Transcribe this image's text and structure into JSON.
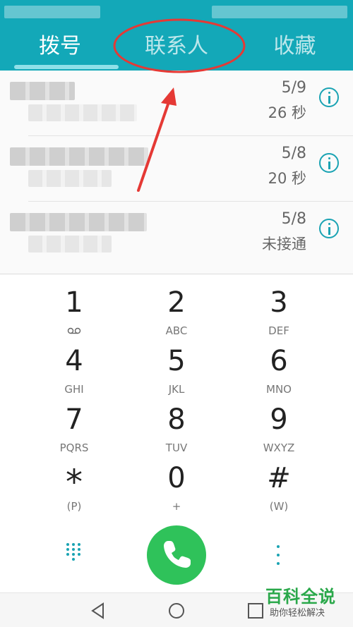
{
  "tabs": [
    {
      "label": "拨号",
      "active": true
    },
    {
      "label": "联系人",
      "active": false
    },
    {
      "label": "收藏",
      "active": false
    }
  ],
  "call_log": [
    {
      "date": "5/9",
      "meta": "26 秒"
    },
    {
      "date": "5/8",
      "meta": "20 秒"
    },
    {
      "date": "5/8",
      "meta": "未接通"
    }
  ],
  "keypad": [
    {
      "digit": "1",
      "letters": ""
    },
    {
      "digit": "2",
      "letters": "ABC"
    },
    {
      "digit": "3",
      "letters": "DEF"
    },
    {
      "digit": "4",
      "letters": "GHI"
    },
    {
      "digit": "5",
      "letters": "JKL"
    },
    {
      "digit": "6",
      "letters": "MNO"
    },
    {
      "digit": "7",
      "letters": "PQRS"
    },
    {
      "digit": "8",
      "letters": "TUV"
    },
    {
      "digit": "9",
      "letters": "WXYZ"
    },
    {
      "digit": "*",
      "letters": "(P)"
    },
    {
      "digit": "0",
      "letters": "+"
    },
    {
      "digit": "#",
      "letters": "(W)"
    }
  ],
  "icons": {
    "info": "info-icon",
    "call": "phone-icon",
    "dialpad": "dialpad-icon",
    "more": "more-vertical-icon",
    "voicemail": "voicemail-icon",
    "nav_back": "back-triangle-icon",
    "nav_home": "home-circle-icon",
    "nav_recents": "recents-square-icon"
  },
  "watermark": {
    "title": "百科全说",
    "subtitle": "助你轻松解决"
  },
  "colors": {
    "header": "#13a8b8",
    "accent": "#1aa3b3",
    "call": "#2fc25a",
    "annotation": "#e53935"
  }
}
